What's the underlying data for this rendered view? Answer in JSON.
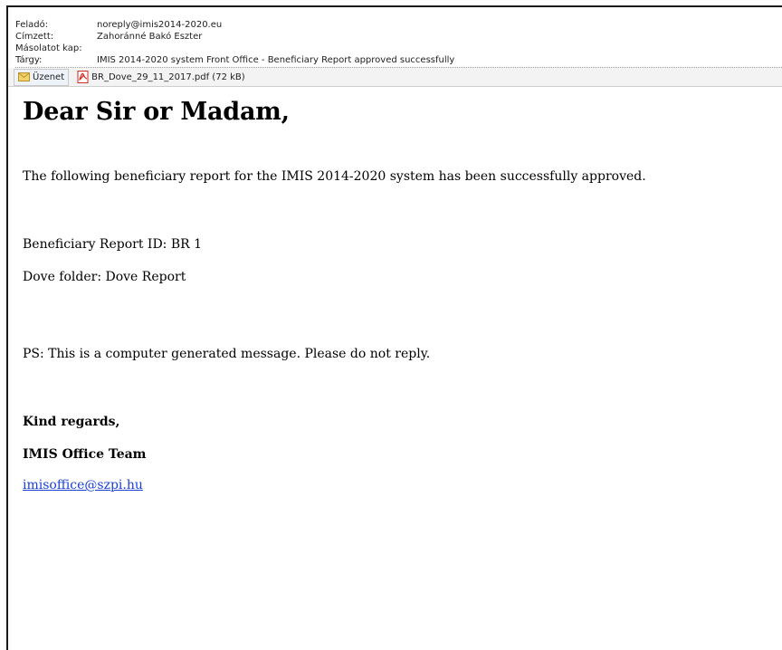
{
  "header": {
    "from_label": "Feladó:",
    "from_value": "noreply@imis2014-2020.eu",
    "to_label": "Címzett:",
    "to_value": "Zahoránné Bakó Eszter",
    "cc_label": "Másolatot kap:",
    "cc_value": "",
    "subject_label": "Tárgy:",
    "subject_value": "IMIS 2014-2020 system Front Office - Beneficiary Report approved successfully"
  },
  "tabs": {
    "message_label": "Üzenet",
    "attachment_label": "BR_Dove_29_11_2017.pdf (72 kB)",
    "message_icon": "envelope-icon",
    "attachment_icon": "pdf-file-icon"
  },
  "email": {
    "greeting": "Dear Sir or Madam,",
    "intro": "The following beneficiary report for the IMIS 2014-2020 system has been successfully approved.",
    "report_id": "Beneficiary Report ID: BR 1",
    "dove_folder": "Dove folder: Dove Report",
    "ps": "PS: This is a computer generated message. Please do not reply.",
    "regards": "Kind regards,",
    "team": "IMIS Office Team",
    "email_link": "imisoffice@szpi.hu"
  },
  "colors": {
    "link": "#1a3fd6",
    "pdf_red": "#d42a20",
    "envelope": "#e8c34a"
  }
}
